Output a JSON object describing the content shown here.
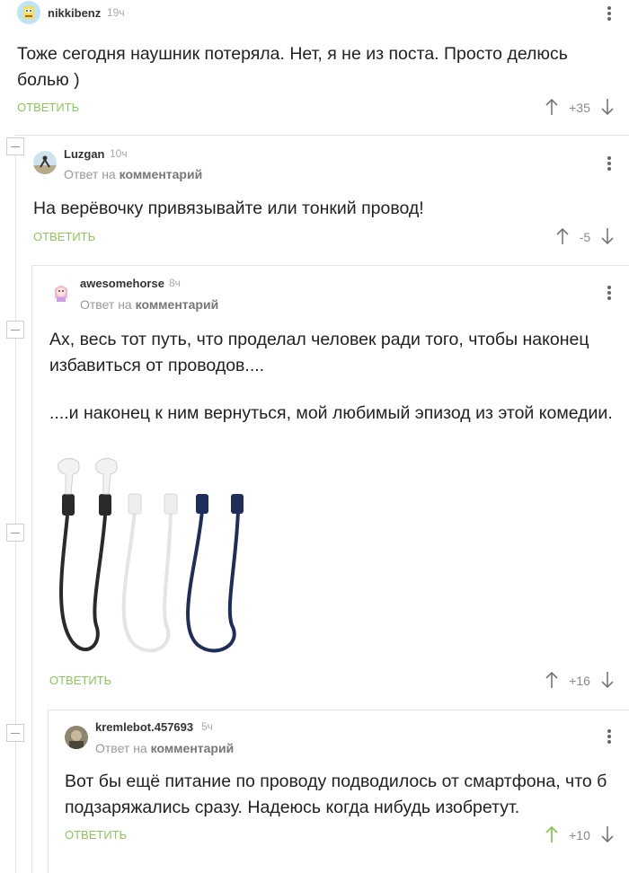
{
  "reply_label": "ответить",
  "reply_prefix": "Ответ на",
  "reply_target": "комментарий",
  "comments": [
    {
      "username": "nikkibenz",
      "time": "19ч",
      "text": "Тоже сегодня наушник потеряла. Нет, я не из поста. Просто делюсь болью )",
      "score": "+35"
    },
    {
      "username": "Luzgan",
      "time": "10ч",
      "text": "На верёвочку привязывайте или тонкий провод!",
      "score": "-5"
    },
    {
      "username": "awesomehorse",
      "time": "8ч",
      "text1": "Ах, весь тот путь, что проделал человек ради того, чтобы наконец избавиться от проводов....",
      "text2": "....и наконец к ним вернуться, мой любимый эпизод из этой комедии.",
      "score": "+16"
    },
    {
      "username": "kremlebot.457693",
      "time": "5ч",
      "text": "Вот бы ещё питание по проводу подводилось от смартфона, что б подзаряжались сразу. Надеюсь когда нибудь изобретут.",
      "score": "+10"
    }
  ],
  "colors": {
    "reply_green": "#8ac858",
    "upvote_active": "#8ac858",
    "tree_line": "#e3e3e3",
    "text": "#222222",
    "muted": "#999999"
  },
  "icons": [
    "collapse-icon",
    "upvote-icon",
    "downvote-icon",
    "more-icon"
  ]
}
